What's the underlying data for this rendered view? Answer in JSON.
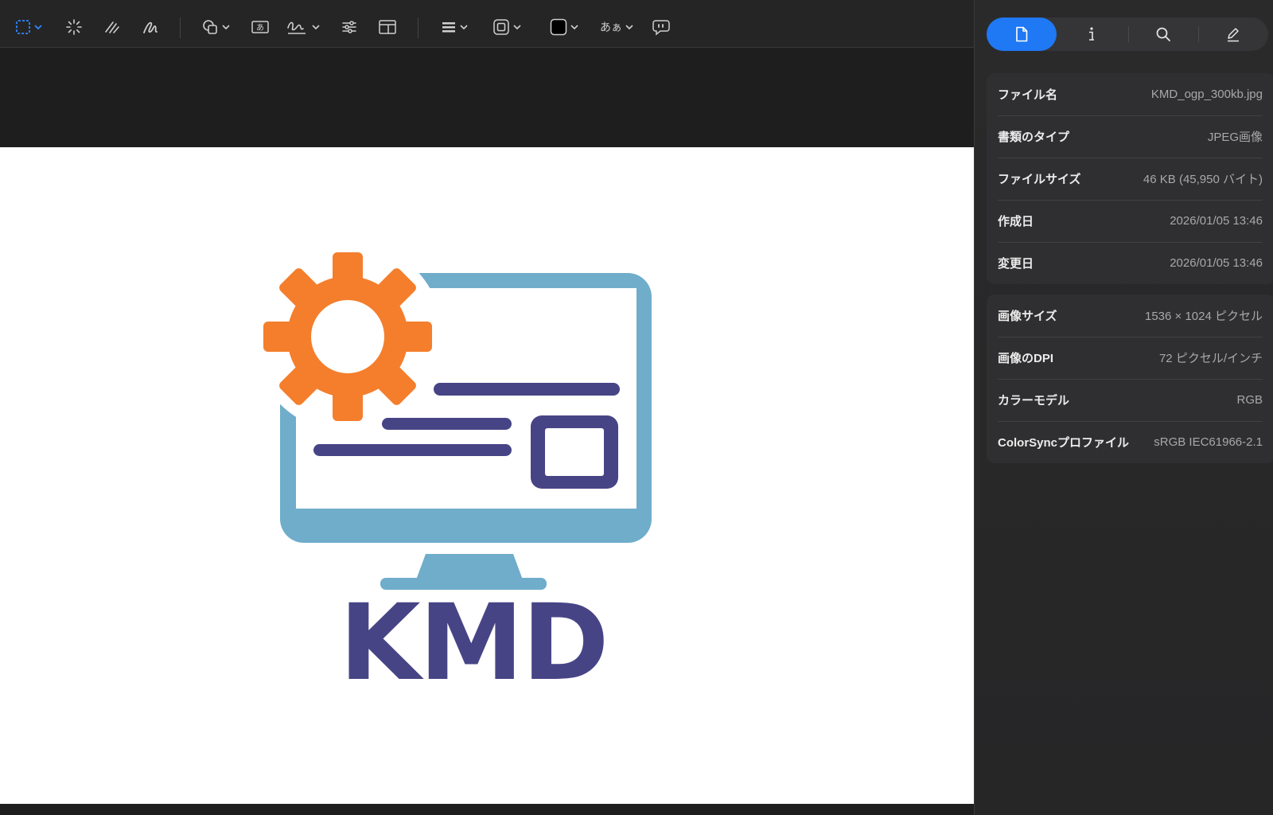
{
  "toolbar": {
    "tools": [
      {
        "id": "selection",
        "icon": "rect-selection-icon",
        "active": true
      },
      {
        "id": "instant-alpha",
        "icon": "magic-wand-icon"
      },
      {
        "id": "sketch",
        "icon": "sketch-icon"
      },
      {
        "id": "draw",
        "icon": "draw-icon"
      },
      {
        "id": "shapes",
        "icon": "shapes-icon"
      },
      {
        "id": "text",
        "icon": "text-box-icon"
      },
      {
        "id": "sign",
        "icon": "signature-icon"
      },
      {
        "id": "adjust-color",
        "icon": "sliders-icon"
      },
      {
        "id": "adjust-size",
        "icon": "resize-icon"
      },
      {
        "id": "shape-style",
        "icon": "line-style-icon"
      },
      {
        "id": "border-color",
        "icon": "border-color-icon"
      },
      {
        "id": "fill-color",
        "icon": "fill-color-icon"
      },
      {
        "id": "text-style",
        "icon": "text-style-icon",
        "label": "あぁ"
      },
      {
        "id": "comment",
        "icon": "speech-bubble-icon"
      }
    ],
    "accent": "#1f78f4"
  },
  "canvas": {
    "logo_text": "KMD",
    "colors": {
      "gear": "#f47e2c",
      "monitor": "#6fadca",
      "text": "#474486",
      "background": "#ffffff"
    }
  },
  "inspector": {
    "tabs": [
      {
        "id": "file",
        "icon": "document-icon",
        "active": true
      },
      {
        "id": "info",
        "icon": "info-icon"
      },
      {
        "id": "search",
        "icon": "search-icon"
      },
      {
        "id": "annotate",
        "icon": "pen-icon"
      }
    ],
    "file_info": [
      {
        "label": "ファイル名",
        "value": "KMD_ogp_300kb.jpg"
      },
      {
        "label": "書類のタイプ",
        "value": "JPEG画像"
      },
      {
        "label": "ファイルサイズ",
        "value": "46 KB (45,950 バイト)"
      },
      {
        "label": "作成日",
        "value": "2026/01/05 13:46"
      },
      {
        "label": "変更日",
        "value": "2026/01/05 13:46"
      }
    ],
    "image_info": [
      {
        "label": "画像サイズ",
        "value": "1536 × 1024 ピクセル"
      },
      {
        "label": "画像のDPI",
        "value": "72 ピクセル/インチ"
      },
      {
        "label": "カラーモデル",
        "value": "RGB"
      },
      {
        "label": "ColorSyncプロファイル",
        "value": "sRGB IEC61966-2.1"
      }
    ]
  }
}
